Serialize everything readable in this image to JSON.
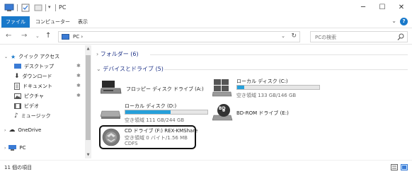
{
  "window": {
    "title": "PC",
    "minimize": "─",
    "maximize": "☐",
    "close": "✕"
  },
  "ribbon": {
    "tabs": [
      {
        "label": "ファイル",
        "active": true
      },
      {
        "label": "コンピューター",
        "active": false
      },
      {
        "label": "表示",
        "active": false
      }
    ]
  },
  "address": {
    "path": "PC  ›",
    "search_placeholder": "PCの検索"
  },
  "nav": {
    "quick_access": "クイック アクセス",
    "items": [
      {
        "label": "デスクトップ",
        "pinned": true
      },
      {
        "label": "ダウンロード",
        "pinned": true
      },
      {
        "label": "ドキュメント",
        "pinned": true
      },
      {
        "label": "ピクチャ",
        "pinned": true
      },
      {
        "label": "ビデオ",
        "pinned": false
      },
      {
        "label": "ミュージック",
        "pinned": false
      }
    ],
    "onedrive": "OneDrive",
    "pc": "PC"
  },
  "content": {
    "folders_group": {
      "label": "フォルダー",
      "count": "(6)"
    },
    "devices_group": {
      "label": "デバイスとドライブ",
      "count": "(5)"
    },
    "drives": [
      {
        "name": "フロッピー ディスク ドライブ (A:)",
        "info": "",
        "icon": "floppy-drive-icon"
      },
      {
        "name": "ローカル ディスク (C:)",
        "info": "空き領域 133 GB/146 GB",
        "used_fraction": 0.09,
        "icon": "windows-drive-icon"
      },
      {
        "name": "ローカル ディスク (D:)",
        "info": "空き領域 111 GB/244 GB",
        "used_fraction": 0.55,
        "icon": "hard-drive-icon"
      },
      {
        "name": "BD-ROM ドライブ (E:)",
        "info": "",
        "icon": "bd-rom-drive-icon"
      },
      {
        "name": "CD ドライブ (F:) REX-KMShare",
        "info": "空き領域 0 バイト/1.56 MB",
        "fs": "CDFS",
        "icon": "cd-drive-icon"
      }
    ]
  },
  "status": {
    "item_count": "11 個の項目"
  },
  "colors": {
    "accent": "#1979ca",
    "bar_fill": "#26a0da",
    "selection": "#cce8ff",
    "group_header": "#1e3287"
  }
}
